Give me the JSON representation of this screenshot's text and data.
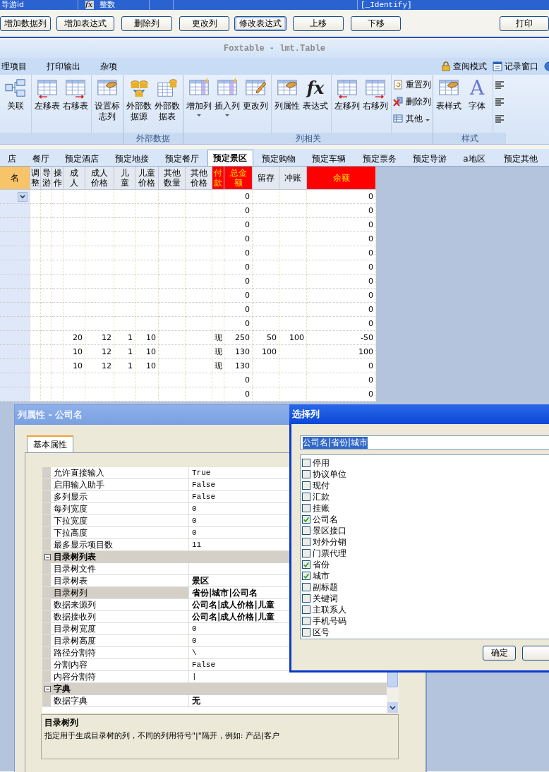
{
  "field_row": {
    "name": "导游id",
    "expr_icon": "fx",
    "type": "整数",
    "identity": "[_Identify]"
  },
  "buttons": [
    {
      "label": "增加数据列",
      "focused": false
    },
    {
      "label": "增加表达式",
      "focused": false
    },
    {
      "label": "删除列",
      "focused": false
    },
    {
      "label": "更改列",
      "focused": false
    },
    {
      "label": "修改表达式",
      "focused": true
    },
    {
      "label": "上移",
      "focused": false
    },
    {
      "label": "下移",
      "focused": false
    },
    {
      "label": "打印",
      "focused": false
    }
  ],
  "window": {
    "title": "Foxtable - lmt.Table"
  },
  "menu": {
    "items": [
      "理项目",
      "打印输出",
      "杂项"
    ],
    "right": [
      {
        "label": "查阅模式",
        "kind": "lock"
      },
      {
        "label": "记录窗口",
        "kind": "window"
      }
    ]
  },
  "ribbon": {
    "groups": [
      {
        "sets": [
          [
            {
              "label": "关联",
              "kind": "relation",
              "dropdown": false
            }
          ],
          [
            {
              "label": "左移表",
              "kind": "table-left",
              "dropdown": false
            },
            {
              "label": "右移表",
              "kind": "table-right",
              "dropdown": false
            }
          ],
          [
            {
              "label": "设置标志列",
              "kind": "table-hand",
              "dropdown": false
            }
          ]
        ]
      },
      {
        "label": "外部数据",
        "sets": [
          [
            {
              "label": "外部数据源",
              "kind": "db",
              "dropdown": false
            },
            {
              "label": "外部数据表",
              "kind": "db-table",
              "dropdown": false
            }
          ]
        ]
      },
      {
        "label": "列相关",
        "sets": [
          [
            {
              "label": "增加列",
              "kind": "col-star",
              "dropdown": true
            },
            {
              "label": "插入列",
              "kind": "col-star",
              "dropdown": true
            },
            {
              "label": "更改列",
              "kind": "col-pen",
              "dropdown": false
            }
          ],
          [
            {
              "label": "列属性",
              "kind": "doc-hand",
              "dropdown": false
            },
            {
              "label": "表达式",
              "kind": "fx",
              "glyph": "fx",
              "dropdown": false
            }
          ],
          [
            {
              "label": "左移列",
              "kind": "table-left",
              "dropdown": false
            },
            {
              "label": "右移列",
              "kind": "table-right",
              "dropdown": false
            }
          ],
          [
            {
              "label": "重置列",
              "kind": "small-reset",
              "dropdown": false
            },
            {
              "label": "删除列",
              "kind": "small-delete",
              "dropdown": false
            },
            {
              "label": "其他",
              "kind": "small-other",
              "dropdown": true
            }
          ]
        ]
      },
      {
        "label": "样式",
        "sets": [
          [
            {
              "label": "表样式",
              "kind": "table-hand",
              "dropdown": false
            },
            {
              "label": "字体",
              "kind": "font",
              "glyph": "A",
              "dropdown": false
            }
          ],
          [
            {
              "kind": "align",
              "dropdown": false
            },
            {
              "kind": "align",
              "dropdown": false
            },
            {
              "kind": "align",
              "dropdown": false
            }
          ]
        ]
      }
    ]
  },
  "tabs": [
    {
      "label": "店",
      "selected": false
    },
    {
      "label": "餐厅",
      "selected": false
    },
    {
      "label": "预定酒店",
      "selected": false
    },
    {
      "label": "预定地接",
      "selected": false
    },
    {
      "label": "预定餐厅",
      "selected": false
    },
    {
      "label": "预定景区",
      "selected": true
    },
    {
      "label": "预定购物",
      "selected": false
    },
    {
      "label": "预定车辆",
      "selected": false
    },
    {
      "label": "预定票务",
      "selected": false
    },
    {
      "label": "预定导游",
      "selected": false
    },
    {
      "label": "a地区",
      "selected": false
    },
    {
      "label": "预定其他",
      "selected": false
    }
  ],
  "table": {
    "columns": [
      {
        "label": "名",
        "kind": "current"
      },
      {
        "label": "调整",
        "kind": "normal"
      },
      {
        "label": "导游",
        "kind": "normal"
      },
      {
        "label": "操作",
        "kind": "normal"
      },
      {
        "label": "成人",
        "kind": "normal"
      },
      {
        "label": "成人价格",
        "kind": "normal"
      },
      {
        "label": "儿童",
        "kind": "normal"
      },
      {
        "label": "儿童价格",
        "kind": "normal"
      },
      {
        "label": "其他数量",
        "kind": "normal"
      },
      {
        "label": "其他价格",
        "kind": "normal"
      },
      {
        "label": "付款",
        "kind": "alert"
      },
      {
        "label": "总金额",
        "kind": "alert"
      },
      {
        "label": "留存",
        "kind": "normal"
      },
      {
        "label": "冲账",
        "kind": "normal"
      },
      {
        "label": "余额",
        "kind": "alert"
      }
    ],
    "rows": [
      {
        "editing": true,
        "cells": [
          null,
          null,
          null,
          null,
          null,
          null,
          null,
          null,
          null,
          null,
          null,
          "0",
          null,
          null,
          "0"
        ]
      },
      {
        "editing": false,
        "cells": [
          null,
          null,
          null,
          null,
          null,
          null,
          null,
          null,
          null,
          null,
          null,
          "0",
          null,
          null,
          "0"
        ]
      },
      {
        "editing": false,
        "cells": [
          null,
          null,
          null,
          null,
          null,
          null,
          null,
          null,
          null,
          null,
          null,
          "0",
          null,
          null,
          "0"
        ]
      },
      {
        "editing": false,
        "cells": [
          null,
          null,
          null,
          null,
          null,
          null,
          null,
          null,
          null,
          null,
          null,
          "0",
          null,
          null,
          "0"
        ]
      },
      {
        "editing": false,
        "cells": [
          null,
          null,
          null,
          null,
          null,
          null,
          null,
          null,
          null,
          null,
          null,
          "0",
          null,
          null,
          "0"
        ]
      },
      {
        "editing": false,
        "cells": [
          null,
          null,
          null,
          null,
          null,
          null,
          null,
          null,
          null,
          null,
          null,
          "0",
          null,
          null,
          "0"
        ]
      },
      {
        "editing": false,
        "cells": [
          null,
          null,
          null,
          null,
          null,
          null,
          null,
          null,
          null,
          null,
          null,
          "0",
          null,
          null,
          "0"
        ]
      },
      {
        "editing": false,
        "cells": [
          null,
          null,
          null,
          null,
          null,
          null,
          null,
          null,
          null,
          null,
          null,
          "0",
          null,
          null,
          "0"
        ]
      },
      {
        "editing": false,
        "cells": [
          null,
          null,
          null,
          null,
          null,
          null,
          null,
          null,
          null,
          null,
          null,
          "0",
          null,
          null,
          "0"
        ]
      },
      {
        "editing": false,
        "cells": [
          null,
          null,
          null,
          null,
          null,
          null,
          null,
          null,
          null,
          null,
          null,
          "0",
          null,
          null,
          "0"
        ]
      },
      {
        "editing": false,
        "cells": [
          null,
          null,
          null,
          null,
          "20",
          "12",
          "1",
          "10",
          null,
          null,
          "现",
          "250",
          "50",
          "100",
          "-50"
        ]
      },
      {
        "editing": false,
        "cells": [
          null,
          null,
          null,
          null,
          "10",
          "12",
          "1",
          "10",
          null,
          null,
          "现",
          "130",
          "100",
          null,
          "100"
        ]
      },
      {
        "editing": false,
        "cells": [
          null,
          null,
          null,
          null,
          "10",
          "12",
          "1",
          "10",
          null,
          null,
          "现",
          "130",
          null,
          null,
          "0"
        ]
      },
      {
        "editing": false,
        "cells": [
          null,
          null,
          null,
          null,
          null,
          null,
          null,
          null,
          null,
          null,
          null,
          "0",
          null,
          null,
          "0"
        ]
      },
      {
        "editing": false,
        "cells": [
          null,
          null,
          null,
          null,
          null,
          null,
          null,
          null,
          null,
          null,
          null,
          "0",
          null,
          null,
          "0"
        ]
      }
    ]
  },
  "property_dialog": {
    "title": "列属性 - 公司名",
    "tabs": [
      {
        "label": "基本属性",
        "selected": true
      }
    ],
    "rows": [
      {
        "kind": "prop",
        "name": "允许直接输入",
        "value": "True",
        "modified": false,
        "selected": false
      },
      {
        "kind": "prop",
        "name": "启用输入助手",
        "value": "False",
        "modified": false,
        "selected": false
      },
      {
        "kind": "prop",
        "name": "多列显示",
        "value": "False",
        "modified": false,
        "selected": false
      },
      {
        "kind": "prop",
        "name": "每列宽度",
        "value": "0",
        "modified": false,
        "selected": false
      },
      {
        "kind": "prop",
        "name": "下拉宽度",
        "value": "0",
        "modified": false,
        "selected": false
      },
      {
        "kind": "prop",
        "name": "下拉高度",
        "value": "0",
        "modified": false,
        "selected": false
      },
      {
        "kind": "prop",
        "name": "最多显示项目数",
        "value": "11",
        "modified": false,
        "selected": false
      },
      {
        "kind": "category",
        "name": "目录树列表",
        "expanded": true
      },
      {
        "kind": "prop",
        "name": "目录树文件",
        "selected": false
      },
      {
        "kind": "prop",
        "name": "目录树表",
        "value": "景区",
        "modified": true,
        "selected": false
      },
      {
        "kind": "prop",
        "name": "目录树列",
        "value": "省份|城市|公司名",
        "modified": true,
        "selected": true
      },
      {
        "kind": "prop",
        "name": "数据来源列",
        "value": "公司名|成人价格|儿童",
        "modified": true,
        "selected": false
      },
      {
        "kind": "prop",
        "name": "数据接收列",
        "value": "公司名|成人价格|儿童",
        "modified": true,
        "selected": false
      },
      {
        "kind": "prop",
        "name": "目录树宽度",
        "value": "0",
        "modified": false,
        "selected": false
      },
      {
        "kind": "prop",
        "name": "目录树高度",
        "value": "0",
        "modified": false,
        "selected": false
      },
      {
        "kind": "prop",
        "name": "路径分割符",
        "value": "\\",
        "modified": false,
        "selected": false
      },
      {
        "kind": "prop",
        "name": "分割内容",
        "value": "False",
        "modified": false,
        "selected": false
      },
      {
        "kind": "prop",
        "name": "内容分割符",
        "value": "|",
        "modified": false,
        "selected": false
      },
      {
        "kind": "category",
        "name": "字典",
        "expanded": true
      },
      {
        "kind": "prop",
        "name": "数据字典",
        "value": "无",
        "modified": true,
        "selected": false
      }
    ],
    "description": {
      "title": "目录树列",
      "text": "指定用于生成目录树的列，不同的列用符号\"|\"隔开，例如: 产品|客户"
    }
  },
  "select_dialog": {
    "title": "选择列",
    "field": {
      "value": "公司名|省份|城市",
      "text_selected": true
    },
    "options": [
      {
        "label": "停用",
        "checked": false
      },
      {
        "label": "协议单位",
        "checked": false
      },
      {
        "label": "现付",
        "checked": false
      },
      {
        "label": "汇款",
        "checked": false
      },
      {
        "label": "挂账",
        "checked": false
      },
      {
        "label": "公司名",
        "checked": true
      },
      {
        "label": "景区接口",
        "checked": false
      },
      {
        "label": "对外分销",
        "checked": false
      },
      {
        "label": "门票代理",
        "checked": false
      },
      {
        "label": "省份",
        "checked": true
      },
      {
        "label": "城市",
        "checked": true
      },
      {
        "label": "副标题",
        "checked": false
      },
      {
        "label": "关键词",
        "checked": false
      },
      {
        "label": "主联系人",
        "checked": false
      },
      {
        "label": "手机号码",
        "checked": false
      },
      {
        "label": "区号",
        "checked": false
      }
    ],
    "buttons": [
      "确定"
    ]
  }
}
